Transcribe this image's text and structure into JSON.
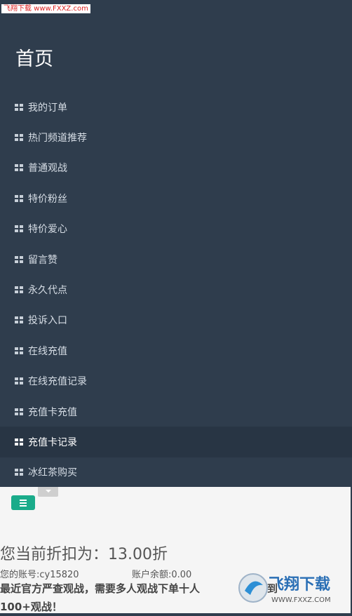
{
  "watermark_top": "飞翔下载 www.FXXZ.com",
  "page_title": "首页",
  "menu": [
    {
      "label": "我的订单"
    },
    {
      "label": "热门频道推荐"
    },
    {
      "label": "普通观战"
    },
    {
      "label": "特价粉丝"
    },
    {
      "label": "特价爱心"
    },
    {
      "label": "留言赞"
    },
    {
      "label": "永久代点"
    },
    {
      "label": "投诉入口"
    },
    {
      "label": "在线充值"
    },
    {
      "label": "在线充值记录"
    },
    {
      "label": "充值卡充值"
    },
    {
      "label": "充值卡记录"
    },
    {
      "label": "冰红茶购买"
    }
  ],
  "active_index": 11,
  "content": {
    "discount": "您当前折扣为：13.00折",
    "account": "您的账号:cy15820",
    "balance": "账户余额:0.00",
    "notice": "最近官方严查观战，需要多人观战下单十人",
    "notice_tail_1": "到",
    "notice_line2": "100+观战！"
  },
  "watermark_bottom": {
    "brand": "飞翔下载",
    "url": "WWW.FXXZ.COM"
  },
  "colors": {
    "sidebar": "#2f3d4d",
    "active": "#283544",
    "accent": "#1aab8a"
  }
}
